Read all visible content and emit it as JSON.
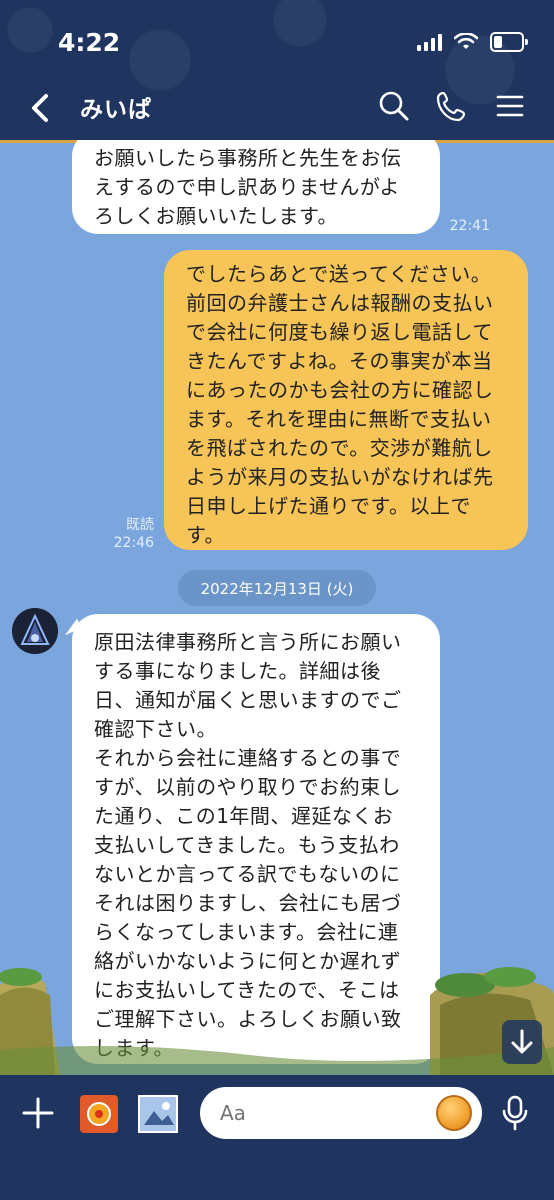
{
  "status_bar": {
    "time": "4:22"
  },
  "header": {
    "title": "みいぱ"
  },
  "messages": [
    {
      "direction": "incoming",
      "text": "お願いしたら事務所と先生をお伝\nえするので申し訳ありませんがよ\nろしくお願いいたします。",
      "time": "22:41"
    },
    {
      "direction": "outgoing",
      "text": "でしたらあとで送ってください。\n前回の弁護士さんは報酬の支払い\nで会社に何度も繰り返し電話して\nきたんですよね。その事実が本当\nにあったのかも会社の方に確認し\nます。それを理由に無断で支払い\nを飛ばされたので。交渉が難航し\nようが来月の支払いがなければ先\n日申し上げた通りです。以上で\nす。",
      "read": "既読",
      "time": "22:46"
    },
    {
      "direction": "incoming",
      "text": "原田法律事務所と言う所にお願い\nする事になりました。詳細は後\n日、通知が届くと思いますのでご\n確認下さい。\nそれから会社に連絡するとの事で\nすが、以前のやり取りでお約束し\nた通り、この1年間、遅延なくお\n支払いしてきました。もう支払わ\nないとか言ってる訳でもないのに\nそれは困りますし、会社にも居づ\nらくなってしまいます。会社に連\n絡がいかないように何とか遅れず\nにお支払いしてきたので、そこは\nご理解下さい。よろしくお願い致\nします。"
    }
  ],
  "date_separator": "2022年12月13日 (火)",
  "input": {
    "placeholder": "Aa"
  },
  "colors": {
    "header_bg": "#1f3560",
    "chat_bg": "#7aa6dd",
    "outgoing_bubble": "#f6c457",
    "incoming_bubble": "#ffffff",
    "accent": "#d9a441"
  }
}
